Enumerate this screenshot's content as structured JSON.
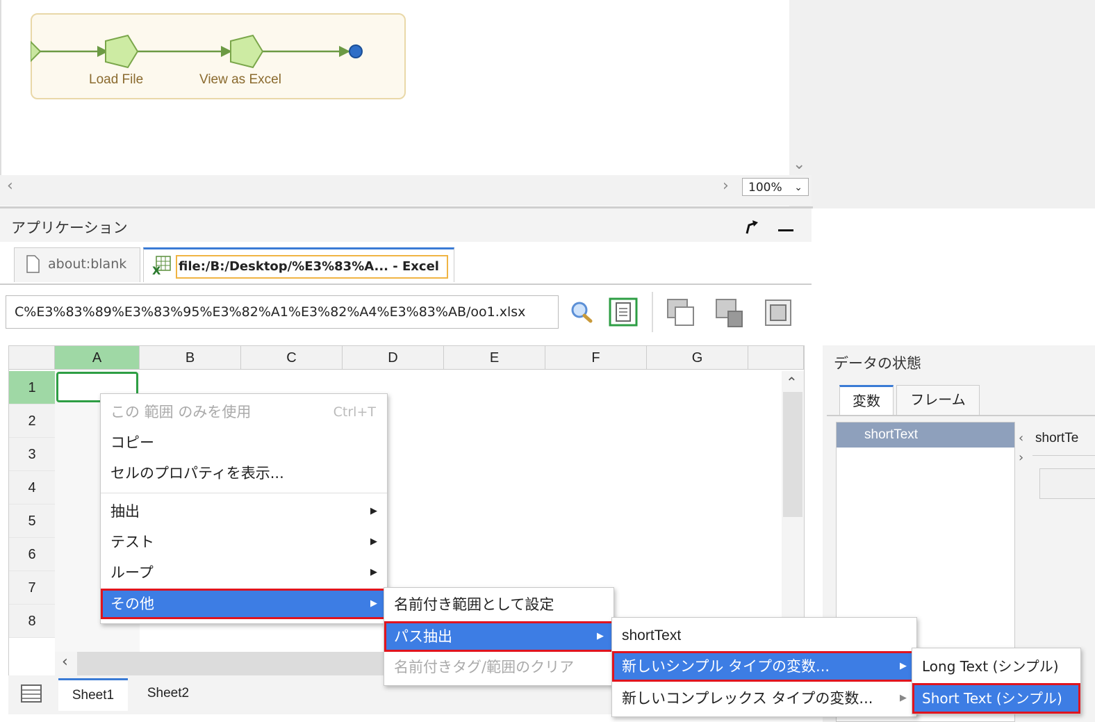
{
  "workflow": {
    "steps": [
      "Load File",
      "View as Excel"
    ],
    "zoom": "100%"
  },
  "app": {
    "title": "アプリケーション",
    "tabs": [
      {
        "label": "about:blank"
      },
      {
        "label": "file:/B:/Desktop/%E3%83%A... - Excel"
      }
    ],
    "url": "C%E3%83%89%E3%83%95%E3%82%A1%E3%82%A4%E3%83%AB/oo1.xlsx"
  },
  "grid": {
    "columns": [
      "A",
      "B",
      "C",
      "D",
      "E",
      "F",
      "G"
    ],
    "rows": [
      "1",
      "2",
      "3",
      "4",
      "5",
      "6",
      "7",
      "8"
    ],
    "sheets": [
      "Sheet1",
      "Sheet2"
    ]
  },
  "context_menu": {
    "items": [
      {
        "label": "この 範囲 のみを使用",
        "shortcut": "Ctrl+T"
      },
      {
        "label": "コピー"
      },
      {
        "label": "セルのプロパティを表示..."
      },
      {
        "label": "抽出"
      },
      {
        "label": "テスト"
      },
      {
        "label": "ループ"
      },
      {
        "label": "その他"
      }
    ]
  },
  "submenu_other": {
    "items": [
      {
        "label": "名前付き範囲として設定"
      },
      {
        "label": "パス抽出"
      },
      {
        "label": "名前付きタグ/範囲のクリア"
      }
    ]
  },
  "submenu_path": {
    "items": [
      {
        "label": "shortText"
      },
      {
        "label": "新しいシンプル タイプの変数..."
      },
      {
        "label": "新しいコンプレックス タイプの変数..."
      }
    ]
  },
  "submenu_simple": {
    "items": [
      {
        "label": "Long Text (シンプル)"
      },
      {
        "label": "Short Text (シンプル)"
      }
    ]
  },
  "data_pane": {
    "title": "データの状態",
    "tabs": [
      "変数",
      "フレーム"
    ],
    "variables": [
      "shortText"
    ],
    "detail_label": "shortTe"
  },
  "colors": {
    "menu_highlight": "#3d7de4",
    "highlight_border": "#e0141e",
    "selected_cell": "#2e9e44",
    "header_selected": "#9fd8a5"
  }
}
